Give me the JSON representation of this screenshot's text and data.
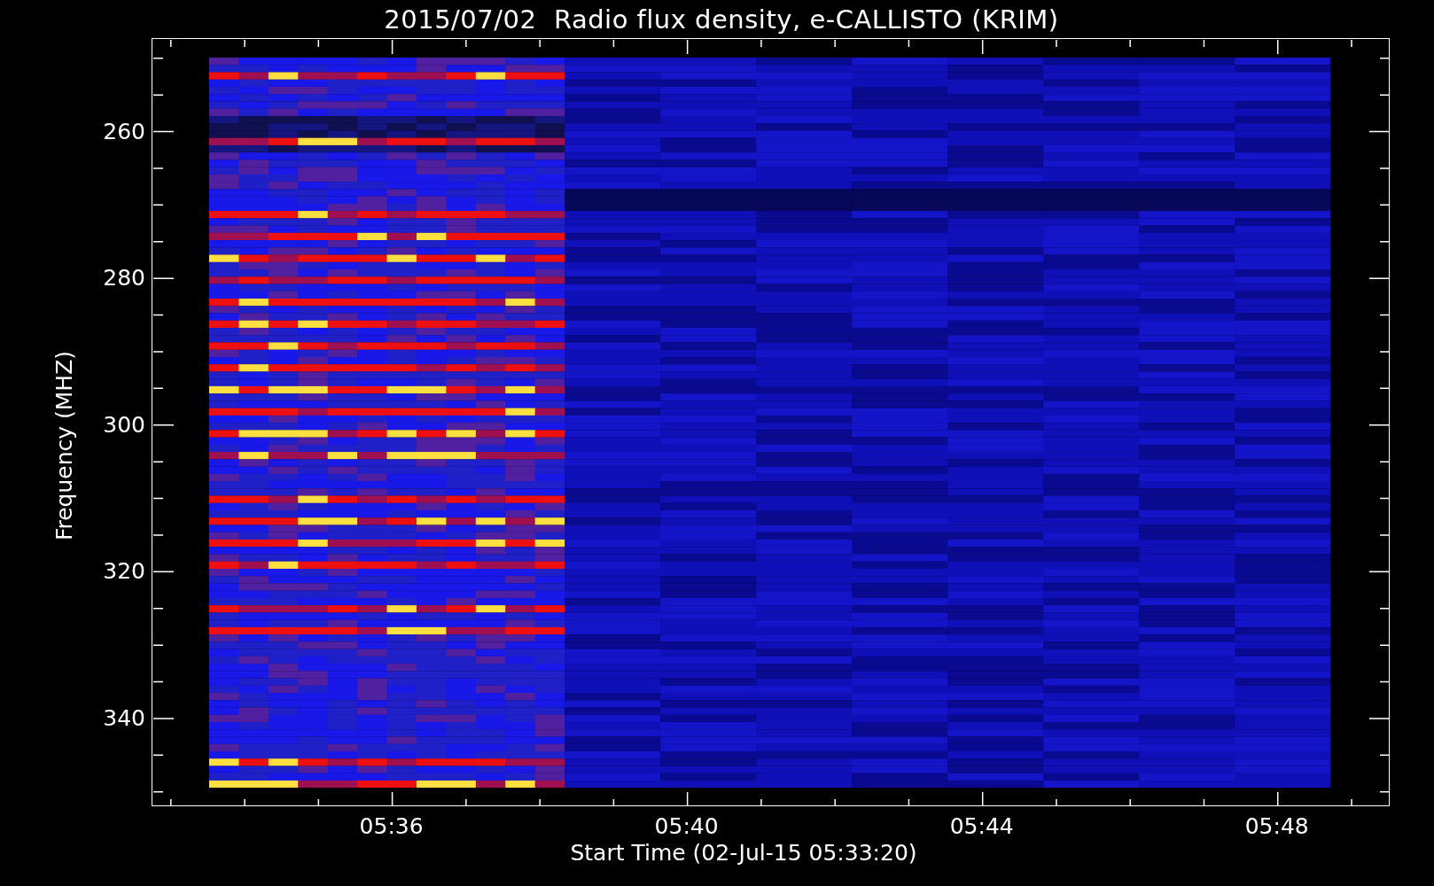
{
  "title": "2015/07/02  Radio flux density, e-CALLISTO (KRIM)",
  "y_axis": {
    "label": "Frequency (MHZ)",
    "ticks": [
      "260",
      "280",
      "300",
      "320",
      "340"
    ]
  },
  "x_axis": {
    "label": "Start Time (02-Jul-15 05:33:20)",
    "ticks": [
      "05:36",
      "05:40",
      "05:44",
      "05:48"
    ]
  }
}
